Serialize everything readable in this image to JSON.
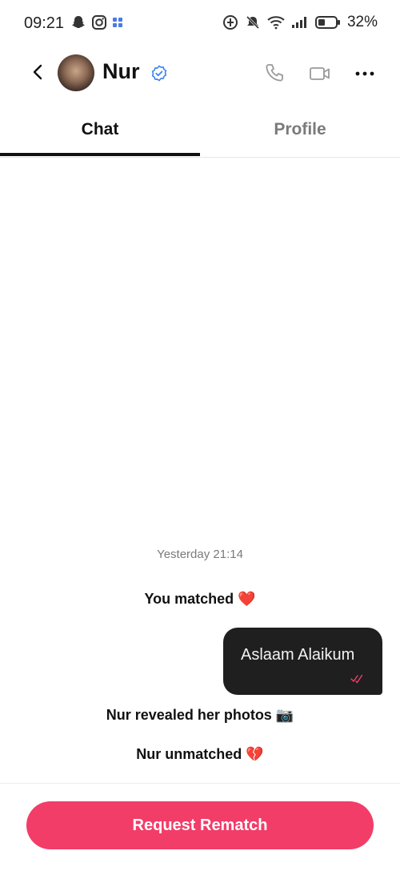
{
  "status_bar": {
    "time": "09:21",
    "battery": "32%",
    "icons_left": [
      "snapchat-icon",
      "instagram-icon",
      "app-grid-icon"
    ],
    "icons_right": [
      "data-saver-icon",
      "mute-icon",
      "wifi-icon",
      "signal-icon",
      "battery-icon"
    ]
  },
  "header": {
    "name": "Nur",
    "verified": true,
    "actions": [
      "phone-icon",
      "video-icon",
      "more-icon"
    ]
  },
  "tabs": [
    {
      "label": "Chat",
      "active": true
    },
    {
      "label": "Profile",
      "active": false
    }
  ],
  "conversation": {
    "timestamp": "Yesterday 21:14",
    "events": {
      "matched": "You matched ❤️",
      "revealed": "Nur revealed her photos 📷",
      "unmatched": "Nur unmatched 💔"
    },
    "message": {
      "text": "Aslaam Alaikum",
      "outgoing": true,
      "read": true
    }
  },
  "footer": {
    "button_label": "Request Rematch"
  },
  "colors": {
    "accent": "#f23d69",
    "bubble": "#1f1f1f",
    "verified": "#3b82f6"
  }
}
